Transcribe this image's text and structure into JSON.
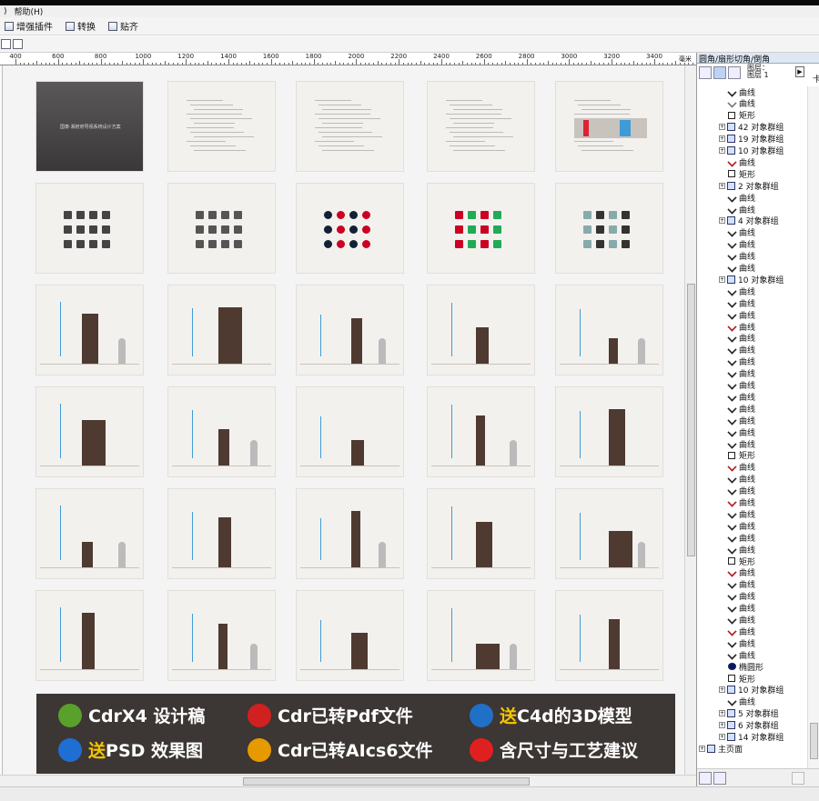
{
  "menu": {
    "items": [
      ")",
      "帮助(H)"
    ]
  },
  "toolbar": {
    "enhance_label": "增强插件",
    "convert_label": "转换",
    "snap_label": "贴齐"
  },
  "ruler": {
    "labels": [
      "400",
      "600",
      "800",
      "1000",
      "1200",
      "1400",
      "1600",
      "1800",
      "2000",
      "2200",
      "2400",
      "2600",
      "2800",
      "3000",
      "3200",
      "3400"
    ],
    "unit": "毫米"
  },
  "canvas": {
    "cover_title": "国泰·湘府府导视系统设计方案"
  },
  "banner": {
    "items": [
      {
        "pre": "CdrX4 设计稿",
        "hl": "",
        "post": "",
        "icon": "coreldraw-icon",
        "color": "#5aa02c"
      },
      {
        "pre": "Cdr已转Pdf文件",
        "hl": "",
        "post": "",
        "icon": "pdf-icon",
        "color": "#d02020"
      },
      {
        "pre": "",
        "hl": "送",
        "post": "C4d的3D模型",
        "icon": "cinema4d-icon",
        "color": "#2070c8"
      },
      {
        "pre": "",
        "hl": "送",
        "post": "PSD 效果图",
        "icon": "photoshop-icon",
        "color": "#1f6ed4"
      },
      {
        "pre": "Cdr已转AIcs6文件",
        "hl": "",
        "post": "",
        "icon": "illustrator-icon",
        "color": "#e79a00"
      },
      {
        "pre": "含尺寸与工艺建议",
        "hl": "",
        "post": "",
        "icon": "alert-icon",
        "color": "#e02020"
      }
    ]
  },
  "panel": {
    "title": "圆角/扇形切角/倒角",
    "layer_label_1": "图层：",
    "layer_label_2": "图层 1",
    "right_edge_text": "卡",
    "tree": [
      {
        "type": "curve",
        "label": "曲线",
        "indent": 2,
        "color": "#222"
      },
      {
        "type": "curve",
        "label": "曲线",
        "indent": 2,
        "color": "#777"
      },
      {
        "type": "rect",
        "label": "矩形",
        "indent": 2
      },
      {
        "type": "group",
        "label": "42 对象群组",
        "indent": 1
      },
      {
        "type": "group",
        "label": "19 对象群组",
        "indent": 1
      },
      {
        "type": "group",
        "label": "10 对象群组",
        "indent": 1
      },
      {
        "type": "curve",
        "label": "曲线",
        "indent": 2,
        "color": "#b01818"
      },
      {
        "type": "rect",
        "label": "矩形",
        "indent": 2
      },
      {
        "type": "group",
        "label": "2 对象群组",
        "indent": 1
      },
      {
        "type": "curve",
        "label": "曲线",
        "indent": 2,
        "color": "#222"
      },
      {
        "type": "curve",
        "label": "曲线",
        "indent": 2,
        "color": "#222"
      },
      {
        "type": "group",
        "label": "4 对象群组",
        "indent": 1
      },
      {
        "type": "curve",
        "label": "曲线",
        "indent": 2,
        "color": "#222"
      },
      {
        "type": "curve",
        "label": "曲线",
        "indent": 2,
        "color": "#222"
      },
      {
        "type": "curve",
        "label": "曲线",
        "indent": 2,
        "color": "#222"
      },
      {
        "type": "curve",
        "label": "曲线",
        "indent": 2,
        "color": "#222"
      },
      {
        "type": "group",
        "label": "10 对象群组",
        "indent": 1
      },
      {
        "type": "curve",
        "label": "曲线",
        "indent": 2,
        "color": "#222"
      },
      {
        "type": "curve",
        "label": "曲线",
        "indent": 2,
        "color": "#222"
      },
      {
        "type": "curve",
        "label": "曲线",
        "indent": 2,
        "color": "#222"
      },
      {
        "type": "curve",
        "label": "曲线",
        "indent": 2,
        "color": "#b01818"
      },
      {
        "type": "curve",
        "label": "曲线",
        "indent": 2,
        "color": "#222"
      },
      {
        "type": "curve",
        "label": "曲线",
        "indent": 2,
        "color": "#222"
      },
      {
        "type": "curve",
        "label": "曲线",
        "indent": 2,
        "color": "#222"
      },
      {
        "type": "curve",
        "label": "曲线",
        "indent": 2,
        "color": "#222"
      },
      {
        "type": "curve",
        "label": "曲线",
        "indent": 2,
        "color": "#222"
      },
      {
        "type": "curve",
        "label": "曲线",
        "indent": 2,
        "color": "#222"
      },
      {
        "type": "curve",
        "label": "曲线",
        "indent": 2,
        "color": "#222"
      },
      {
        "type": "curve",
        "label": "曲线",
        "indent": 2,
        "color": "#222"
      },
      {
        "type": "curve",
        "label": "曲线",
        "indent": 2,
        "color": "#222"
      },
      {
        "type": "curve",
        "label": "曲线",
        "indent": 2,
        "color": "#222"
      },
      {
        "type": "rect",
        "label": "矩形",
        "indent": 2
      },
      {
        "type": "curve",
        "label": "曲线",
        "indent": 2,
        "color": "#b01818"
      },
      {
        "type": "curve",
        "label": "曲线",
        "indent": 2,
        "color": "#222"
      },
      {
        "type": "curve",
        "label": "曲线",
        "indent": 2,
        "color": "#222"
      },
      {
        "type": "curve",
        "label": "曲线",
        "indent": 2,
        "color": "#b01818"
      },
      {
        "type": "curve",
        "label": "曲线",
        "indent": 2,
        "color": "#222"
      },
      {
        "type": "curve",
        "label": "曲线",
        "indent": 2,
        "color": "#222"
      },
      {
        "type": "curve",
        "label": "曲线",
        "indent": 2,
        "color": "#222"
      },
      {
        "type": "curve",
        "label": "曲线",
        "indent": 2,
        "color": "#222"
      },
      {
        "type": "rect",
        "label": "矩形",
        "indent": 2
      },
      {
        "type": "curve",
        "label": "曲线",
        "indent": 2,
        "color": "#b01818"
      },
      {
        "type": "curve",
        "label": "曲线",
        "indent": 2,
        "color": "#222"
      },
      {
        "type": "curve",
        "label": "曲线",
        "indent": 2,
        "color": "#222"
      },
      {
        "type": "curve",
        "label": "曲线",
        "indent": 2,
        "color": "#222"
      },
      {
        "type": "curve",
        "label": "曲线",
        "indent": 2,
        "color": "#222"
      },
      {
        "type": "curve",
        "label": "曲线",
        "indent": 2,
        "color": "#b01818"
      },
      {
        "type": "curve",
        "label": "曲线",
        "indent": 2,
        "color": "#222"
      },
      {
        "type": "curve",
        "label": "曲线",
        "indent": 2,
        "color": "#222"
      },
      {
        "type": "ellipse",
        "label": "椭圆形",
        "indent": 2
      },
      {
        "type": "rect",
        "label": "矩形",
        "indent": 2
      },
      {
        "type": "group",
        "label": "10 对象群组",
        "indent": 1
      },
      {
        "type": "curve",
        "label": "曲线",
        "indent": 2,
        "color": "#222"
      },
      {
        "type": "group",
        "label": "5 对象群组",
        "indent": 1
      },
      {
        "type": "group",
        "label": "6 对象群组",
        "indent": 1
      },
      {
        "type": "group",
        "label": "14 对象群组",
        "indent": 1
      },
      {
        "type": "page",
        "label": "主页面",
        "indent": 0
      }
    ]
  }
}
